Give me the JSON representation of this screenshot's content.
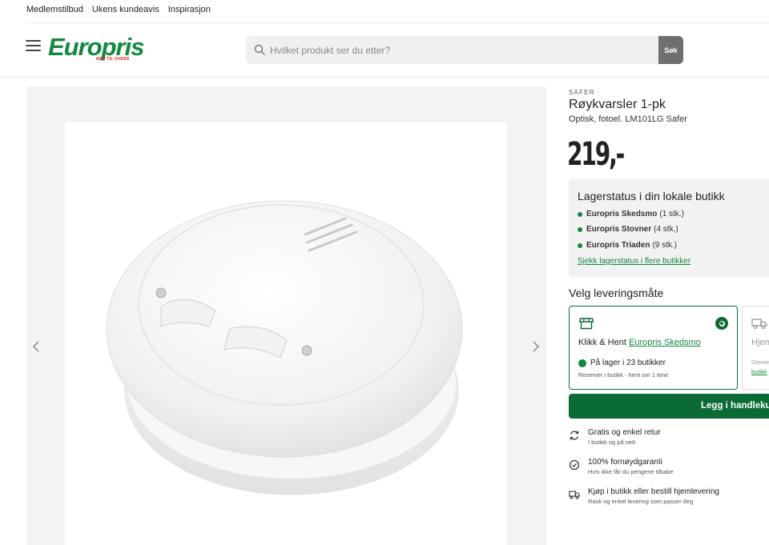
{
  "top_links": [
    "Medlemstilbud",
    "Ukens kundeavis",
    "Inspirasjon"
  ],
  "header": {
    "logo_text": "Europris",
    "logo_tagline": "MER TIL OVERS",
    "search_placeholder": "Hvilket produkt ser du etter?",
    "search_button": "Søk"
  },
  "product": {
    "brand": "SAFER",
    "title": "Røykvarsler 1-pk",
    "subtitle": "Optisk, fotoel. LM101LG Safer",
    "price": "219,-"
  },
  "stock": {
    "title": "Lagerstatus i din lokale butikk",
    "stores": [
      {
        "name": "Europris Skedsmo",
        "qty": "(1 stk.)"
      },
      {
        "name": "Europris Stovner",
        "qty": "(4 stk.)"
      },
      {
        "name": "Europris Triaden",
        "qty": "(9 stk.)"
      }
    ],
    "link": "Sjekk lagerstatus i flere butikker"
  },
  "delivery": {
    "title": "Velg leveringsmåte",
    "option1": {
      "label": "Klikk & Hent",
      "store": "Europris Skedsmo",
      "stock": "På lager i 23 butikker",
      "note": "Reserver i butikk - hent om 1 time",
      "selected": true
    },
    "option2": {
      "label": "Hjem",
      "note1": "Denne",
      "note2": "butikk"
    }
  },
  "cart_button": "Legg i handlekurv",
  "usps": [
    {
      "title": "Gratis og enkel retur",
      "sub": "I butikk og på nett",
      "icon": "refresh-icon"
    },
    {
      "title": "100% fornøydgaranti",
      "sub": "Hvis ikke får du pengene tilbake",
      "icon": "check-circle-icon"
    },
    {
      "title": "Kjøp i butikk eller bestill hjemlevering",
      "sub": "Rask og enkel levering som passer deg",
      "icon": "truck-icon"
    }
  ],
  "colors": {
    "brand_green": "#118a3e",
    "dark_green": "#0b6b35",
    "logo_red": "#d8232a"
  }
}
